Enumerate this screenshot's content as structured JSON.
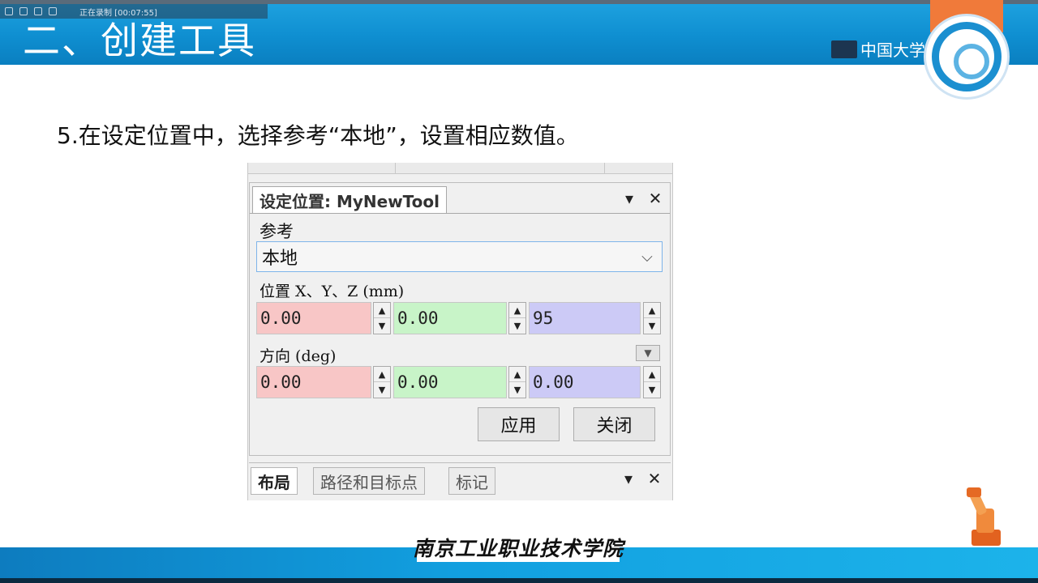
{
  "slide": {
    "title": "二、创建工具",
    "instruction": "5.在设定位置中，选择参考“本地”，设置相应数值。",
    "logo_text": "中国大学MOOC",
    "school_name": "南京工业职业技术学院",
    "recorder_status": "正在录制 [00:07:55]"
  },
  "dialog": {
    "tab_title": "设定位置: MyNewTool",
    "reference_label": "参考",
    "reference_value": "本地",
    "position_label": "位置 X、Y、Z (mm)",
    "position": {
      "x": "0.00",
      "y": "0.00",
      "z": "95"
    },
    "orientation_label": "方向 (deg)",
    "orientation": {
      "x": "0.00",
      "y": "0.00",
      "z": "0.00"
    },
    "apply_label": "应用",
    "close_label": "关闭"
  },
  "bottom_tabs": [
    "布局",
    "路径和目标点",
    "标记"
  ],
  "icons": {
    "pin": "pin-icon",
    "close": "close-icon",
    "dropdown": "chevron-down-icon",
    "spin_up": "arrow-up-icon",
    "spin_down": "arrow-down-icon",
    "expand": "triangle-down-icon"
  },
  "colors": {
    "header_blue": "#0f8fd1",
    "x_field": "#f8c6c6",
    "y_field": "#c8f4c8",
    "z_field": "#cccaf6",
    "combo_border": "#7eb4ea"
  }
}
